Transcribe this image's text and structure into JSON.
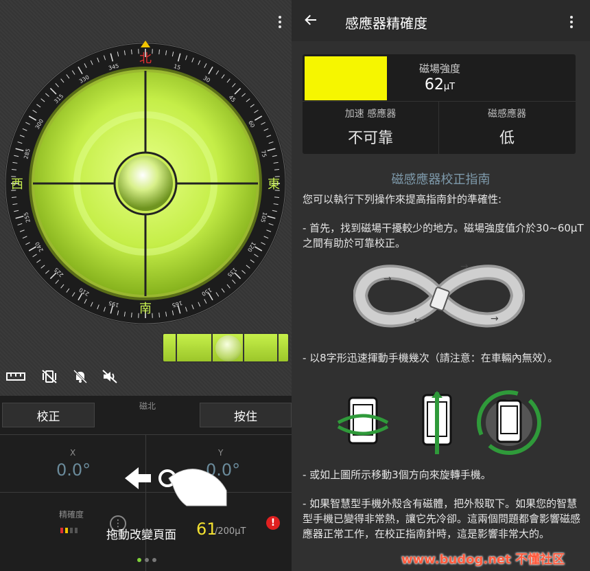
{
  "left": {
    "compass": {
      "cardinals": {
        "north": "北",
        "east": "東",
        "south": "南",
        "west": "西"
      },
      "degree_labels": [
        "345",
        "330",
        "315",
        "300",
        "285",
        "255",
        "240",
        "225",
        "210",
        "195",
        "165",
        "150",
        "135",
        "120",
        "105",
        "75",
        "60",
        "45",
        "30",
        "15"
      ],
      "accent_color": "#c8f050"
    },
    "icons": [
      "ruler-icon",
      "vibration-off-icon",
      "bell-off-icon",
      "volume-off-icon"
    ],
    "calibrate_button": "校正",
    "hold_button": "按住",
    "magnetic_north_label": "磁北",
    "x_label": "X",
    "x_value": "0.0°",
    "y_label": "Y",
    "y_value": "0.0°",
    "accuracy_label": "精確度",
    "strength_value": "61",
    "strength_unit": "/200μT",
    "swipe_hint": "拖動改變頁面",
    "page_count": 3,
    "page_active": 1
  },
  "right": {
    "title": "感應器精確度",
    "magnetic_field_label": "磁場強度",
    "magnetic_field_value": "62",
    "magnetic_field_unit": "μT",
    "accelerometer_label": "加速 感應器",
    "accelerometer_value": "不可靠",
    "magnetometer_label": "磁感應器",
    "magnetometer_value": "低",
    "guide_title": "磁感應器校正指南",
    "intro": "您可以執行下列操作來提高指南針的準確性:",
    "step1": "- 首先，找到磁場干擾較少的地方。磁場強度值介於30~60μT之間有助於可靠校正。",
    "step2": "- 以8字形迅速揮動手機幾次（請注意：在車輛內無效）。",
    "step3": "- 或如上圖所示移動3個方向來旋轉手機。",
    "step4": "- 如果智慧型手機外殼含有磁體，把外殼取下。如果您的智慧型手機已變得非常熱，讓它先冷卻。這兩個問題都會影響磁感應器正常工作，在校正指南針時，這是影響非常大的。",
    "field_bar_color": "#f6f600"
  },
  "watermark": "www.budog.net 不懂社区"
}
